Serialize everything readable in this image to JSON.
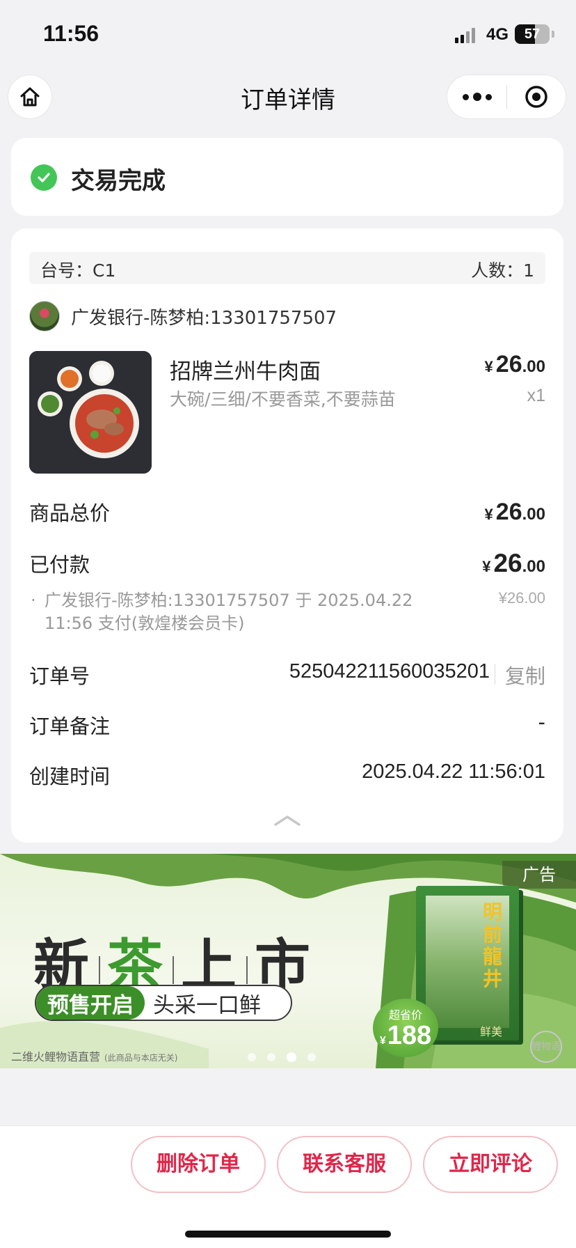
{
  "status_bar": {
    "time": "11:56",
    "network": "4G",
    "battery": "57",
    "battery_level_pct": 57
  },
  "nav": {
    "title": "订单详情",
    "home_icon": "home-icon",
    "more_icon": "more-dots-icon",
    "target_icon": "target-icon"
  },
  "order_status": {
    "text": "交易完成",
    "icon": "check-circle-icon",
    "color": "#43c657"
  },
  "order": {
    "table_label": "台号：C1",
    "people_label": "人数：1",
    "user": "广发银行-陈梦柏:13301757507",
    "item": {
      "name": "招牌兰州牛肉面",
      "spec": "大碗/三细/不要香菜,不要蒜苗",
      "currency": "¥",
      "price_int": "26",
      "price_dec": ".00",
      "qty": "x1"
    },
    "goods_total_label": "商品总价",
    "goods_total_int": "26",
    "goods_total_dec": ".00",
    "paid_label": "已付款",
    "paid_int": "26",
    "paid_dec": ".00",
    "payment_detail": "广发银行-陈梦柏:13301757507 于 2025.04.22 11:56 支付(敦煌楼会员卡)",
    "payment_amount": "¥26.00",
    "order_no_label": "订单号",
    "order_no": "525042211560035201",
    "copy_label": "复制",
    "remark_label": "订单备注",
    "remark_value": "-",
    "created_label": "创建时间",
    "created_value": "2025.04.22 11:56:01"
  },
  "ad": {
    "tag": "广告",
    "title_1": "新",
    "title_2": "茶",
    "title_3": "上",
    "title_4": "市",
    "pill_left": "预售开启",
    "pill_right": "头采一口鲜",
    "product_name": "明前龍井",
    "product_brand": "鲜美",
    "badge_label": "超省价",
    "badge_currency": "¥",
    "badge_price": "188",
    "source": "二维火鲤物语直营",
    "source_note": "(此商品与本店无关)",
    "stamp": "鲤物语",
    "carousel_active_index": 2,
    "carousel_count": 4
  },
  "actions": {
    "delete": "删除订单",
    "service": "联系客服",
    "review": "立即评论"
  },
  "colors": {
    "accent": "#e0264a",
    "success": "#43c657"
  }
}
